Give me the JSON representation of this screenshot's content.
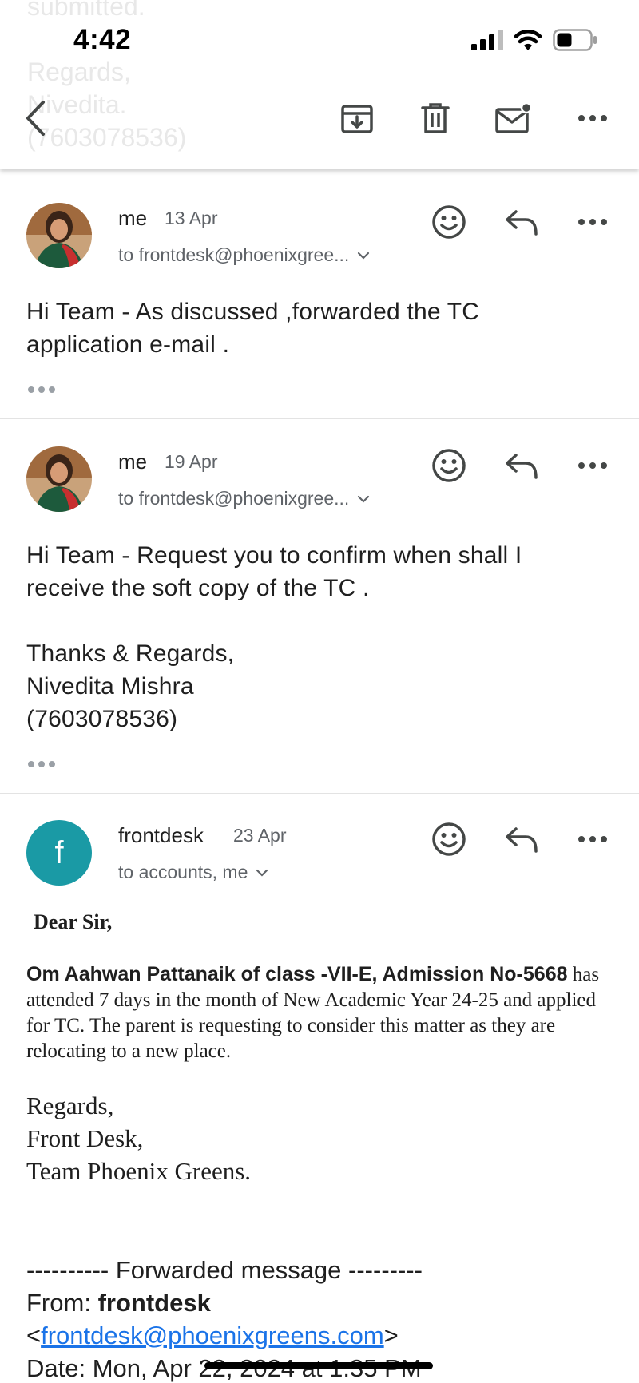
{
  "status_bar": {
    "time": "4:42"
  },
  "background_preview": {
    "lines": "submitted.\n\nRegards,\nNivedita.\n(7603078536)"
  },
  "toolbar": {
    "back": "back",
    "archive": "archive",
    "delete": "delete",
    "mark_unread": "mark-unread",
    "more": "more"
  },
  "messages": [
    {
      "sender": "me",
      "date": "13 Apr",
      "to": "to frontdesk@phoenixgree...",
      "body": "Hi Team - As discussed ,forwarded the TC\napplication e-mail ."
    },
    {
      "sender": "me",
      "date": "19 Apr",
      "to": "to frontdesk@phoenixgree...",
      "body": "Hi Team - Request you to confirm when shall I\nreceive the soft copy of the TC .\n\nThanks & Regards,\nNivedita Mishra\n(7603078536)"
    },
    {
      "sender": "frontdesk",
      "avatar_letter": "f",
      "avatar_color": "#1a9aa5",
      "date": "23 Apr",
      "to": "to accounts, me",
      "greeting": "Dear Sir,",
      "bold_intro": "Om Aahwan Pattanaik of class -VII-E,  Admission No-5668",
      "paragraph": " has attended 7 days in the month of New Academic Year 24-25 and applied for TC. The parent is requesting to consider this matter as they are relocating to a new place.",
      "regards": [
        "Regards,",
        "Front Desk,",
        "Team Phoenix Greens."
      ],
      "forwarded_header": "---------- Forwarded message ---------",
      "from_label": "From: ",
      "from_name": "frontdesk",
      "from_email": "frontdesk@phoenixgreens.com",
      "date_line": "Date: Mon, Apr 22, 2024 at 1:35 PM"
    }
  ],
  "colors": {
    "avatar_f": "#1a9aa5",
    "link": "#1a73e8",
    "icon": "#444746"
  }
}
